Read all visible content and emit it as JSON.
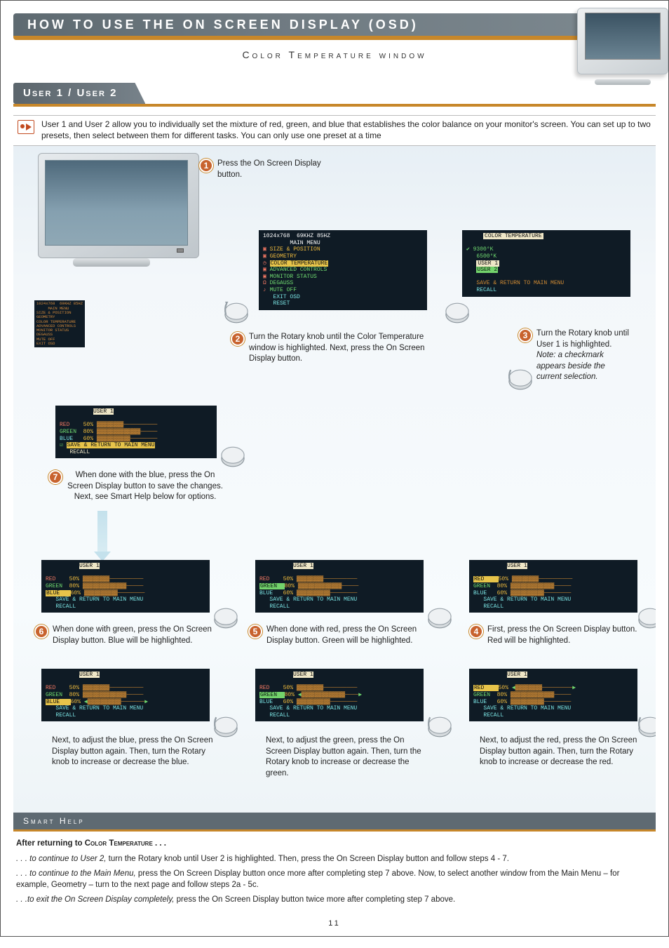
{
  "page_number": "11",
  "header_title": "How to Use the On Screen Display (OSD)",
  "header_subtitle": "Color Temperature window",
  "section_tab": "User 1 / User 2",
  "intro_note": "User 1 and User 2 allow you to individually set the mixture of red, green, and blue that establishes the color balance on your monitor's screen. You can set up to two presets, then select between them for different tasks. You can only use one preset at a time",
  "steps": {
    "s1": "Press the On Screen Display button.",
    "s2": "Turn the Rotary knob until the Color Temperature window is highlighted. Next, press the On Screen Display button.",
    "s3": "Turn the Rotary knob until User 1 is highlighted. Note: a checkmark appears beside the current selection.",
    "s4": "First, press the On Screen Display button. Red will be highlighted.",
    "s4b": "Next, to adjust the red, press the On Screen Display button again. Then, turn the Rotary knob to increase or decrease the red.",
    "s5": "When done with red, press the On Screen Display button. Green will be highlighted.",
    "s5b": "Next, to adjust the green, press the On Screen Display button again. Then, turn the Rotary knob to increase or decrease the green.",
    "s6": "When done with green, press the On Screen Display button. Blue will be highlighted.",
    "s6b": "Next, to adjust the blue, press the On Screen Display button again. Then, turn the Rotary knob to increase or decrease the blue.",
    "s7": "When done with the blue, press the On Screen Display button to save the changes. Next, see Smart Help below for options."
  },
  "osd": {
    "mainmenu": {
      "title": "1024x768  69KHZ 85HZ\n        MAIN MENU",
      "items": [
        "SIZE & POSITION",
        "GEOMETRY",
        "COLOR TEMPERATURE",
        "ADVANCED CONTROLS",
        "MONITOR STATUS",
        "DEGAUSS",
        "MUTE OFF",
        "EXIT OSD",
        "RESET"
      ]
    },
    "colortemp": {
      "title": "COLOR TEMPERATURE",
      "items": [
        "9300°K",
        "6500°K",
        "USER 1",
        "USER 2",
        "SAVE & RETURN TO MAIN MENU",
        "RECALL"
      ]
    },
    "user": {
      "title": "USER 1",
      "red_label": "RED",
      "green_label": "GREEN",
      "blue_label": "BLUE",
      "red_val": "50%",
      "green_val": "80%",
      "blue_val": "60%",
      "save": "SAVE & RETURN TO MAIN MENU",
      "recall": "RECALL"
    },
    "tiny_main": "1024x768  69KHZ 85HZ\n     MAIN MENU\nSIZE & POSITION\nGEOMETRY\nCOLOR TEMPERATURE\nADVANCED CONTROLS\nMONITOR STATUS\nDEGAUSS\nMUTE OFF\nEXIT OSD"
  },
  "smart_help": {
    "tab": "Smart Help",
    "heading": "After returning to Color Temperature . . .",
    "p1_lead": ". . . to continue to User 2,",
    "p1_rest": " turn the Rotary knob until User 2 is highlighted. Then, press the On Screen Display button and follow steps 4 - 7.",
    "p2_lead": ". . . to continue to the Main Menu,",
    "p2_rest": " press the On Screen Display button once more after completing step 7 above. Now, to select another window from the Main Menu – for example, Geometry – turn to the next page and follow steps 2a - 5c.",
    "p3_lead": ". . .to exit the On Screen Display completely,",
    "p3_rest": " press the On Screen Display button twice more after completing step 7 above."
  }
}
